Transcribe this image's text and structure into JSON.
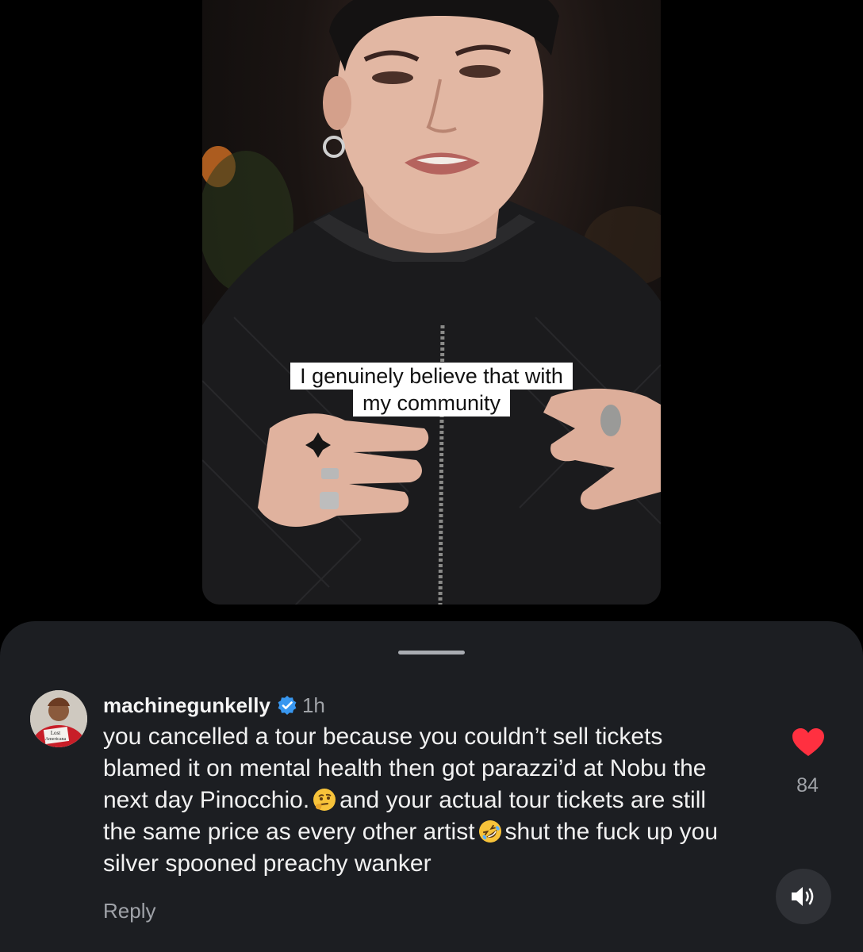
{
  "video": {
    "caption_line1": "I genuinely believe that with",
    "caption_line2": "my community"
  },
  "comment": {
    "username": "machinegunkelly",
    "verified": true,
    "time": "1h",
    "avatar_text": "Lost Americana",
    "text_parts": [
      "you cancelled a tour because you couldn’t sell tickets blamed it on mental health then got parazzi’d at Nobu the next day Pinocchio.",
      "and your actual tour tickets are still the same price as every other artist",
      "shut the fuck up you silver spooned preachy wanker"
    ],
    "emojis": [
      "thinking-face-icon",
      "rofl-face-icon"
    ],
    "reply_label": "Reply",
    "like_count": "84",
    "liked": true
  },
  "colors": {
    "sheet_background": "#1c1e22",
    "like_red": "#ff3040",
    "verified_blue": "#3897f0"
  },
  "icons": [
    "heart-icon",
    "verified-badge-icon",
    "sound-icon"
  ]
}
